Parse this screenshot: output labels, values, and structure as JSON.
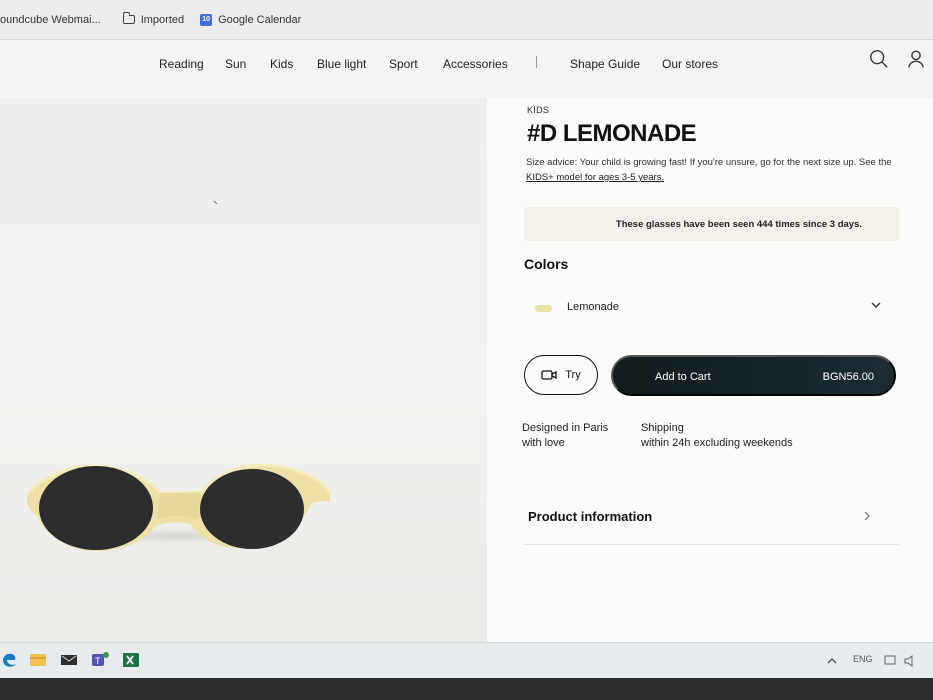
{
  "bookmarks": [
    {
      "label": "oundcube Webmai...",
      "icon": "webmail-icon"
    },
    {
      "label": "Imported",
      "icon": "folder-icon"
    },
    {
      "label": "Google Calendar",
      "icon": "calendar-icon",
      "icon_text": "10"
    }
  ],
  "nav": {
    "items": [
      "Reading",
      "Sun",
      "Kids",
      "Blue light",
      "Sport",
      "Accessories"
    ],
    "secondary": [
      "Shape Guide",
      "Our stores"
    ],
    "icons": [
      "search-icon",
      "account-icon"
    ]
  },
  "product": {
    "category": "KIDS",
    "title": "#D LEMONADE",
    "size_advice": "Size advice: Your child is growing fast! If you're unsure, go for the next size up. See the ",
    "size_link": "KIDS+ model for ages 3-5 years.",
    "seen_banner": "These glasses have been seen 444 times since 3 days.",
    "colors_label": "Colors",
    "selected_color": "Lemonade",
    "swatch_color": "#e8dfa2",
    "try_label": "Try",
    "cart_label": "Add to Cart",
    "price": "BGN56.00",
    "features": [
      {
        "line1": "Designed in Paris",
        "line2": "with love"
      },
      {
        "line1": "Shipping",
        "line2": "within 24h excluding weekends"
      }
    ],
    "info_label": "Product information"
  },
  "taskbar": {
    "tray_language": "ENG",
    "apps": [
      "edge-icon",
      "file-explorer-icon",
      "mail-icon",
      "teams-icon",
      "excel-icon"
    ]
  }
}
